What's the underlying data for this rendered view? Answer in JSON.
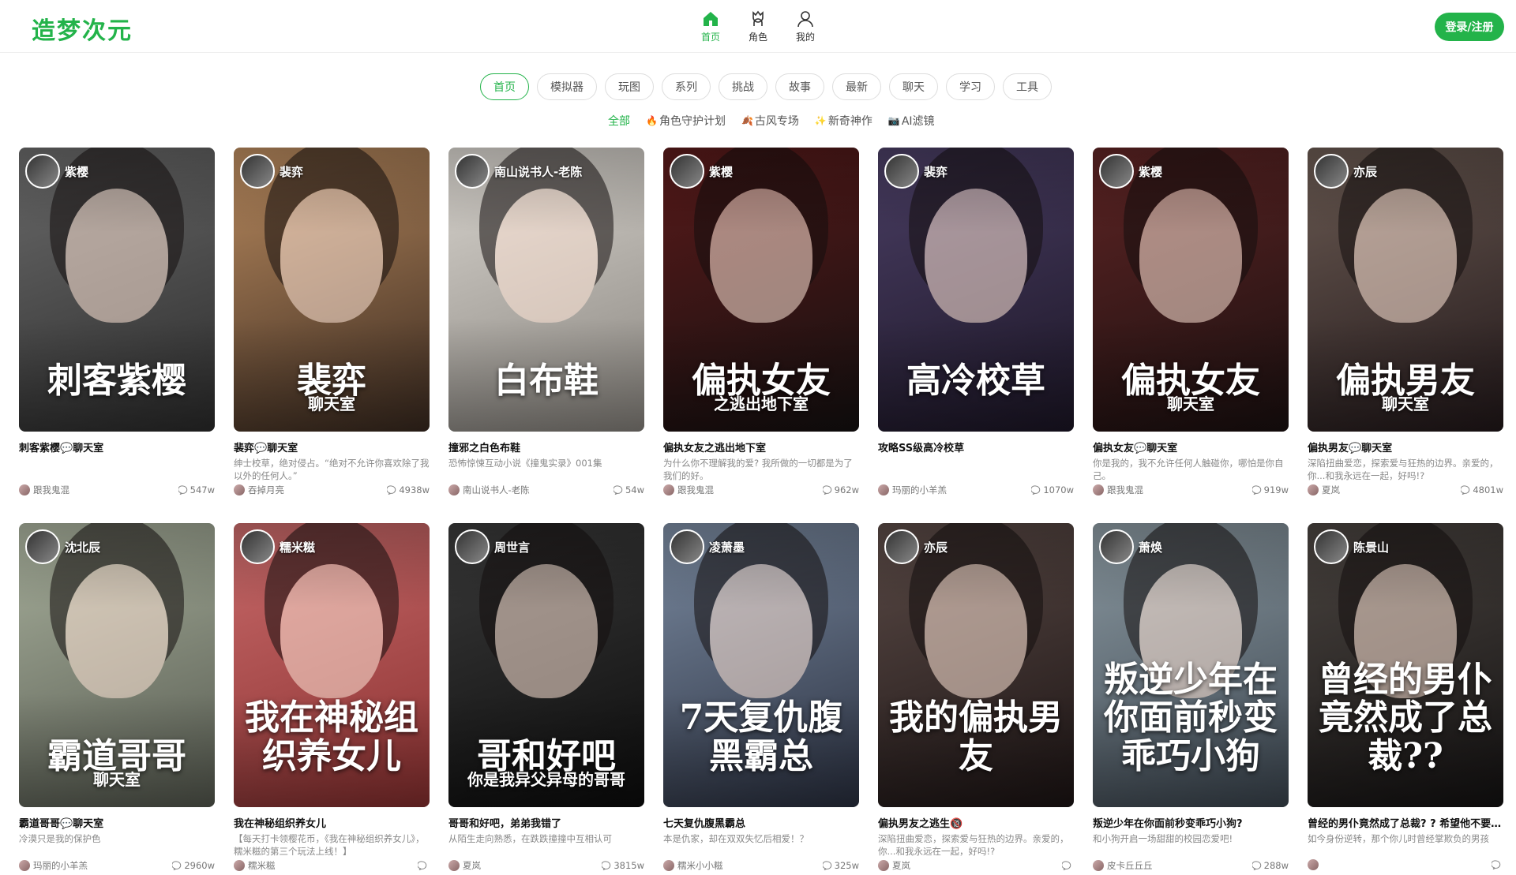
{
  "brand": {
    "logo": "造梦次元",
    "accent": "#23b34a"
  },
  "nav": [
    {
      "label": "首页",
      "icon": "home-icon",
      "active": true
    },
    {
      "label": "角色",
      "icon": "character-icon",
      "active": false
    },
    {
      "label": "我的",
      "icon": "user-icon",
      "active": false
    }
  ],
  "login_label": "登录/注册",
  "tabs": [
    "首页",
    "模拟器",
    "玩图",
    "系列",
    "挑战",
    "故事",
    "最新",
    "聊天",
    "学习",
    "工具"
  ],
  "subtabs": [
    {
      "label": "全部",
      "icon": ""
    },
    {
      "label": "角色守护计划",
      "icon": "🔥"
    },
    {
      "label": "古风专场",
      "icon": "🍂"
    },
    {
      "label": "新奇神作",
      "icon": "✨"
    },
    {
      "label": "AI滤镜",
      "icon": "📷"
    }
  ],
  "cards": [
    {
      "author": "紫樱",
      "cover_text": "刺客紫樱",
      "cover_sub": "",
      "bg": [
        "#6a6a6a",
        "#2c2c2c"
      ],
      "title": "刺客紫樱💬聊天室",
      "desc": "",
      "user": "跟我鬼混",
      "count": "547w"
    },
    {
      "author": "裴弈",
      "cover_text": "裴弈",
      "cover_sub": "聊天室",
      "bg": [
        "#b98a5e",
        "#3a2a20"
      ],
      "title": "裴弈💬聊天室",
      "desc": "绅士校草，绝对侵占。“绝对不允许你喜欢除了我以外的任何人。”",
      "user": "吞掉月亮",
      "count": "4938w"
    },
    {
      "author": "南山说书人-老陈",
      "cover_text": "白布鞋",
      "cover_sub": "",
      "bg": [
        "#d8d4ce",
        "#8a8680"
      ],
      "title": "撞邪之白色布鞋",
      "desc": "恐怖惊悚互动小说《撞鬼实录》001集",
      "user": "南山说书人-老陈",
      "count": "54w"
    },
    {
      "author": "紫樱",
      "cover_text": "偏执女友",
      "cover_sub": "之逃出地下室",
      "bg": [
        "#5a1a1a",
        "#141010"
      ],
      "title": "偏执女友之逃出地下室",
      "desc": "为什么你不理解我的爱? 我所做的一切都是为了我们的好。",
      "user": "跟我鬼混",
      "count": "962w"
    },
    {
      "author": "裴弈",
      "cover_text": "高冷校草",
      "cover_sub": "",
      "bg": [
        "#4a3e64",
        "#1c1626"
      ],
      "title": "攻略SS级高冷校草",
      "desc": "",
      "user": "玛丽的小羊羔",
      "count": "1070w"
    },
    {
      "author": "紫樱",
      "cover_text": "偏执女友",
      "cover_sub": "聊天室",
      "bg": [
        "#5e2424",
        "#1a1010"
      ],
      "title": "偏执女友💬聊天室",
      "desc": "你是我的，我不允许任何人触碰你，哪怕是你自己。",
      "user": "跟我鬼混",
      "count": "919w"
    },
    {
      "author": "亦辰",
      "cover_text": "偏执男友",
      "cover_sub": "聊天室",
      "bg": [
        "#6a5a52",
        "#22181a"
      ],
      "title": "偏执男友💬聊天室",
      "desc": "深陷扭曲爱恋，探索爱与狂热的边界。亲爱的，你...和我永远在一起，好吗!?",
      "user": "夏岚",
      "count": "4801w"
    },
    {
      "author": "沈北辰",
      "cover_text": "霸道哥哥",
      "cover_sub": "聊天室",
      "bg": [
        "#a8b09c",
        "#565a50"
      ],
      "title": "霸道哥哥💬聊天室",
      "desc": "冷漠只是我的保护色",
      "user": "玛丽的小羊羔",
      "count": "2960w"
    },
    {
      "author": "糯米糍",
      "cover_text": "我在神秘组织养女儿",
      "cover_sub": "",
      "bg": [
        "#c86a6a",
        "#8a3030"
      ],
      "title": "我在神秘组织养女儿",
      "desc": "【每天打卡领樱花币，《我在神秘组织养女儿》，糯米糍的第三个玩法上线！】",
      "user": "糯米糍",
      "count": ""
    },
    {
      "author": "周世言",
      "cover_text": "哥和好吧",
      "cover_sub": "你是我异父异母的哥哥",
      "bg": [
        "#3a3a3a",
        "#0c0c0c"
      ],
      "title": "哥哥和好吧，弟弟我错了",
      "desc": "从陌生走向熟悉，在跌跌撞撞中互相认可",
      "user": "夏岚",
      "count": "3815w"
    },
    {
      "author": "凌萧墨",
      "cover_text": "7天复仇腹黑霸总",
      "cover_sub": "",
      "bg": [
        "#7a8aa0",
        "#2a3040"
      ],
      "title": "七天复仇腹黑霸总",
      "desc": "本是仇家，却在双双失忆后相爱！？",
      "user": "糯米小小糍",
      "count": "325w"
    },
    {
      "author": "亦辰",
      "cover_text": "我的偏执男友",
      "cover_sub": "",
      "bg": [
        "#5a4a46",
        "#1c1414"
      ],
      "title": "偏执男友之逃生🔞",
      "desc": "深陷扭曲爱恋，探索爱与狂热的边界。亲爱的，你...和我永远在一起，好吗!?",
      "user": "夏岚",
      "count": ""
    },
    {
      "author": "萧焕",
      "cover_text": "叛逆少年在你面前秒变乖巧小狗",
      "cover_sub": "",
      "bg": [
        "#8a98a0",
        "#3c4650"
      ],
      "title": "叛逆少年在你面前秒变乖巧小狗?",
      "desc": "和小狗开启一场甜甜的校园恋爱吧!",
      "user": "皮卡丘丘丘",
      "count": "288w"
    },
    {
      "author": "陈景山",
      "cover_text": "曾经的男仆竟然成了总裁??",
      "cover_sub": "",
      "bg": [
        "#4a4440",
        "#141212"
      ],
      "title": "曾经的男仆竟然成了总裁? ? 希望他不要记恨我......",
      "desc": "如今身份逆转，那个你儿时曾经掌欺负的男孩",
      "user": "",
      "count": ""
    }
  ]
}
